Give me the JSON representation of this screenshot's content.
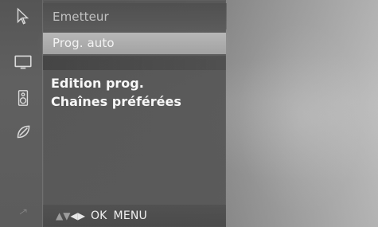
{
  "sidebar": {
    "icons": [
      {
        "name": "pointer-icon"
      },
      {
        "name": "screen-icon"
      },
      {
        "name": "speaker-icon"
      },
      {
        "name": "leaf-icon"
      },
      {
        "name": "arrow-icon"
      }
    ]
  },
  "menu": {
    "submenu_top": "Emetteur",
    "submenu_second": "Prog. auto",
    "items": [
      {
        "label": "Edition prog."
      },
      {
        "label": "Chaînes préférées"
      }
    ],
    "footer": {
      "ok": "OK",
      "menu": "MENU"
    }
  }
}
